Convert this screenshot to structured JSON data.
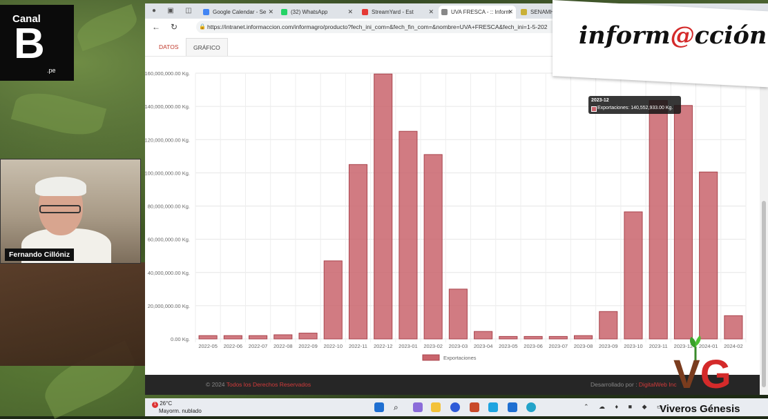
{
  "overlay": {
    "channel_logo": {
      "top": "Canal",
      "letter": "B",
      "suffix": ".pe"
    },
    "webcam_name": "Fernando Cillóniz",
    "info_logo": {
      "pre": "inform",
      "at": "@",
      "post": "cción"
    },
    "vg_logo": {
      "letters_v": "V",
      "letters_g": "G",
      "tagline": "Viveros Génesis"
    }
  },
  "browser": {
    "tabs": [
      {
        "label": "Google Calendar - Se",
        "color": "#4285f4"
      },
      {
        "label": "(32) WhatsApp",
        "color": "#25d366"
      },
      {
        "label": "StreamYard - Est",
        "color": "#e53935"
      },
      {
        "label": "UVA FRESCA - :: Inform",
        "color": "#888888",
        "active": true
      },
      {
        "label": "SENAMHI -",
        "color": "#c9b037"
      }
    ],
    "url": "https://intranet.informaccion.com/informagro/producto?fech_ini_com=&fech_fin_com=&nombre=UVA+FRESCA&fech_ini=1-5-202"
  },
  "page": {
    "tabs": {
      "datos": "DATOS",
      "grafico": "GRÁFICO"
    },
    "tooltip": {
      "title": "2023-12",
      "text": "Exportaciones: 140,552,933.00 Kg."
    },
    "footer": {
      "left_prefix": "© 2024 ",
      "left_link": "Todos los Derechos Reservados",
      "right_prefix": "Desarrollado por : ",
      "right_link": "DigitalWeb Inc"
    }
  },
  "chart_data": {
    "type": "bar",
    "categories": [
      "2022-05",
      "2022-06",
      "2022-07",
      "2022-08",
      "2022-09",
      "2022-10",
      "2022-11",
      "2022-12",
      "2023-01",
      "2023-02",
      "2023-03",
      "2023-04",
      "2023-05",
      "2023-06",
      "2023-07",
      "2023-08",
      "2023-09",
      "2023-10",
      "2023-11",
      "2023-12",
      "2024-01",
      "2024-02"
    ],
    "series": [
      {
        "name": "Exportaciones",
        "values": [
          2000000,
          2000000,
          2000000,
          2500000,
          3500000,
          47000000,
          105000000,
          159500000,
          125000000,
          111000000,
          30000000,
          4500000,
          1500000,
          1500000,
          1500000,
          2000000,
          16500000,
          76500000,
          143500000,
          140552933,
          100500000,
          14000000
        ]
      }
    ],
    "yticks": [
      "0.00 Kg.",
      "20,000,000.00 Kg.",
      "40,000,000.00 Kg.",
      "60,000,000.00 Kg.",
      "80,000,000.00 Kg.",
      "100,000,000.00 Kg.",
      "120,000,000.00 Kg.",
      "140,000,000.00 Kg.",
      "160,000,000.00 Kg."
    ],
    "ylim": [
      0,
      160000000
    ],
    "legend_position": "bottom",
    "grid": true,
    "bar_color": "#c9646c"
  },
  "taskbar": {
    "weather_temp": "26°C",
    "weather_desc": "Mayorm. nublado",
    "badge": "1"
  }
}
